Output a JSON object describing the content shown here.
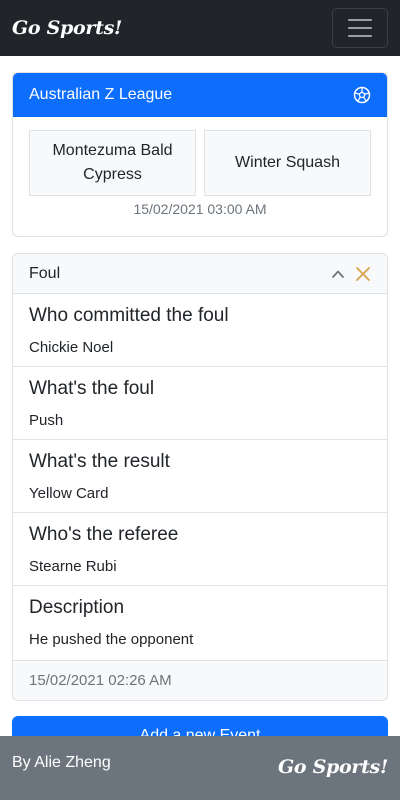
{
  "navbar": {
    "brand": "Go Sports!",
    "menu_icon": "hamburger-menu-icon"
  },
  "match": {
    "league": "Australian Z League",
    "league_icon": "soccer-ball-icon",
    "home_team": "Montezuma Bald Cypress",
    "away_team": "Winter Squash",
    "datetime": "15/02/2021 03:00 AM"
  },
  "event": {
    "type": "Foul",
    "collapse_icon": "chevron-up-icon",
    "close_icon": "close-icon",
    "details": [
      {
        "title": "Who committed the foul",
        "value": "Chickie Noel"
      },
      {
        "title": "What's the foul",
        "value": "Push"
      },
      {
        "title": "What's the result",
        "value": "Yellow Card"
      },
      {
        "title": "Who's the referee",
        "value": "Stearne Rubi"
      },
      {
        "title": "Description",
        "value": "He pushed the opponent"
      }
    ],
    "timestamp": "15/02/2021 02:26 AM"
  },
  "actions": {
    "add_event_label": "Add a new Event"
  },
  "footer": {
    "author": "By Alie Zheng",
    "brand": "Go Sports!"
  },
  "colors": {
    "primary": "#0d6efd",
    "navbar_bg": "#212529",
    "footer_bg": "#6c757d",
    "close_accent": "#d6a24b"
  }
}
